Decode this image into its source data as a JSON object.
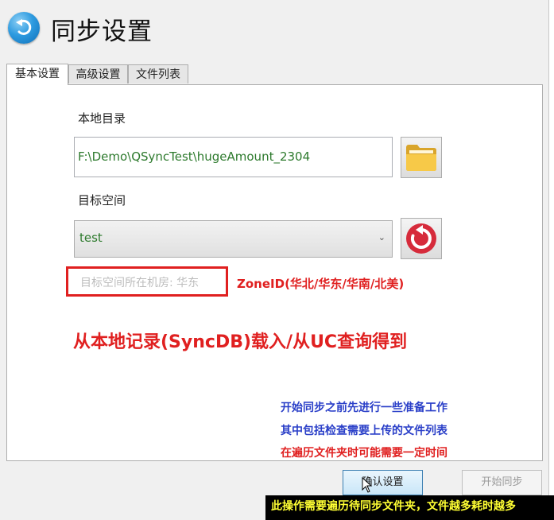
{
  "window": {
    "title": "同步设置"
  },
  "tabs": [
    {
      "label": "基本设置",
      "active": true
    },
    {
      "label": "高级设置",
      "active": false
    },
    {
      "label": "文件列表",
      "active": false
    }
  ],
  "basic": {
    "local_dir_label": "本地目录",
    "local_dir_value": "F:\\Demo\\QSyncTest\\hugeAmount_2304",
    "target_space_label": "目标空间",
    "target_space_value": "test",
    "zone_text": "目标空间所在机房: 华东"
  },
  "annotations": {
    "zone_hint": "ZoneID(华北/华东/华南/北美)",
    "big_note": "从本地记录(SyncDB)载入/从UC查询得到",
    "note_1": "开始同步之前先进行一些准备工作",
    "note_2": "其中包括检查需要上传的文件列表",
    "note_3": "在遍历文件夹时可能需要一定时间"
  },
  "buttons": {
    "confirm_label": "确认设置",
    "start_label": "开始同步"
  },
  "tooltip": "此操作需要遍历待同步文件夹，文件越多耗时越多",
  "icons": {
    "back": "back-arrow-icon",
    "folder": "folder-icon",
    "refresh": "refresh-icon",
    "dropdown": "chevron-down-icon"
  },
  "colors": {
    "accent_blue": "#2e9be0",
    "value_green": "#2d7a2d",
    "annotation_red": "#e02020",
    "annotation_blue": "#2a3fc8",
    "tooltip_text": "#ffff33"
  }
}
